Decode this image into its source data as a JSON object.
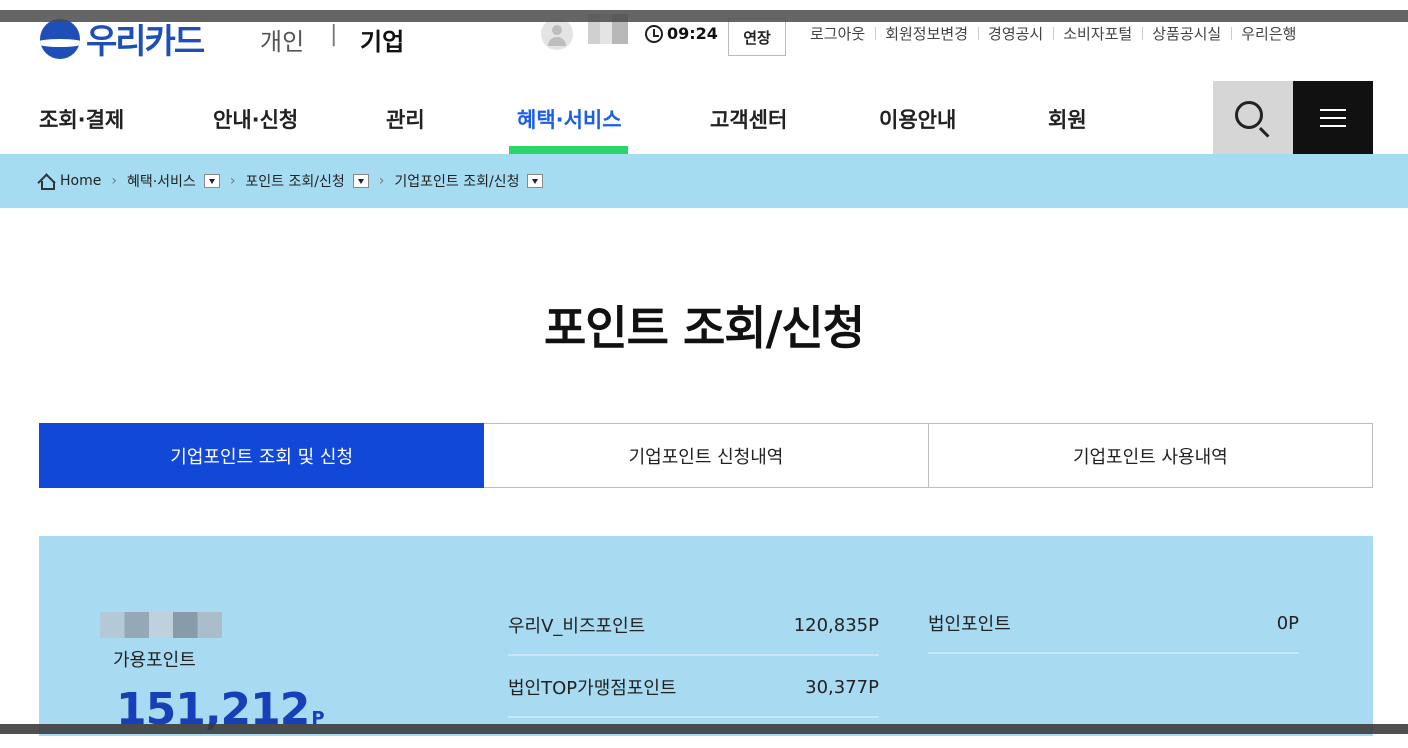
{
  "util": {
    "logo_text": "우리카드",
    "segment_personal": "개인",
    "segment_separator": "|",
    "segment_corporate": "기업",
    "timer": "09:24",
    "extend_label": "연장",
    "links": [
      "로그아웃",
      "회원정보변경",
      "경영공시",
      "소비자포털",
      "상품공시실",
      "우리은행"
    ]
  },
  "gnb": {
    "items": [
      "조회·결제",
      "안내·신청",
      "관리",
      "혜택·서비스",
      "고객센터",
      "이용안내",
      "회원"
    ],
    "active": "혜택·서비스",
    "accent_color": "#2ad66a"
  },
  "breadcrumb": {
    "home": "Home",
    "items": [
      "혜택·서비스",
      "포인트 조회/신청",
      "기업포인트 조회/신청"
    ]
  },
  "page": {
    "title": "포인트 조회/신청"
  },
  "tabs": [
    {
      "label": "기업포인트 조회 및 신청",
      "active": true
    },
    {
      "label": "기업포인트 신청내역",
      "active": false
    },
    {
      "label": "기업포인트 사용내역",
      "active": false
    }
  ],
  "points": {
    "available_label": "가용포인트",
    "available_value": "151,212",
    "available_unit": "P",
    "rows": [
      {
        "label": "우리V_비즈포인트",
        "value": "120,835P"
      },
      {
        "label": "법인TOP가맹점포인트",
        "value": "30,377P"
      },
      {
        "label": "법인포인트",
        "value": "0P"
      }
    ]
  },
  "colors": {
    "brand_blue": "#1f4fb6",
    "active_tab": "#1248d8",
    "panel_bg": "#a8daf2"
  }
}
